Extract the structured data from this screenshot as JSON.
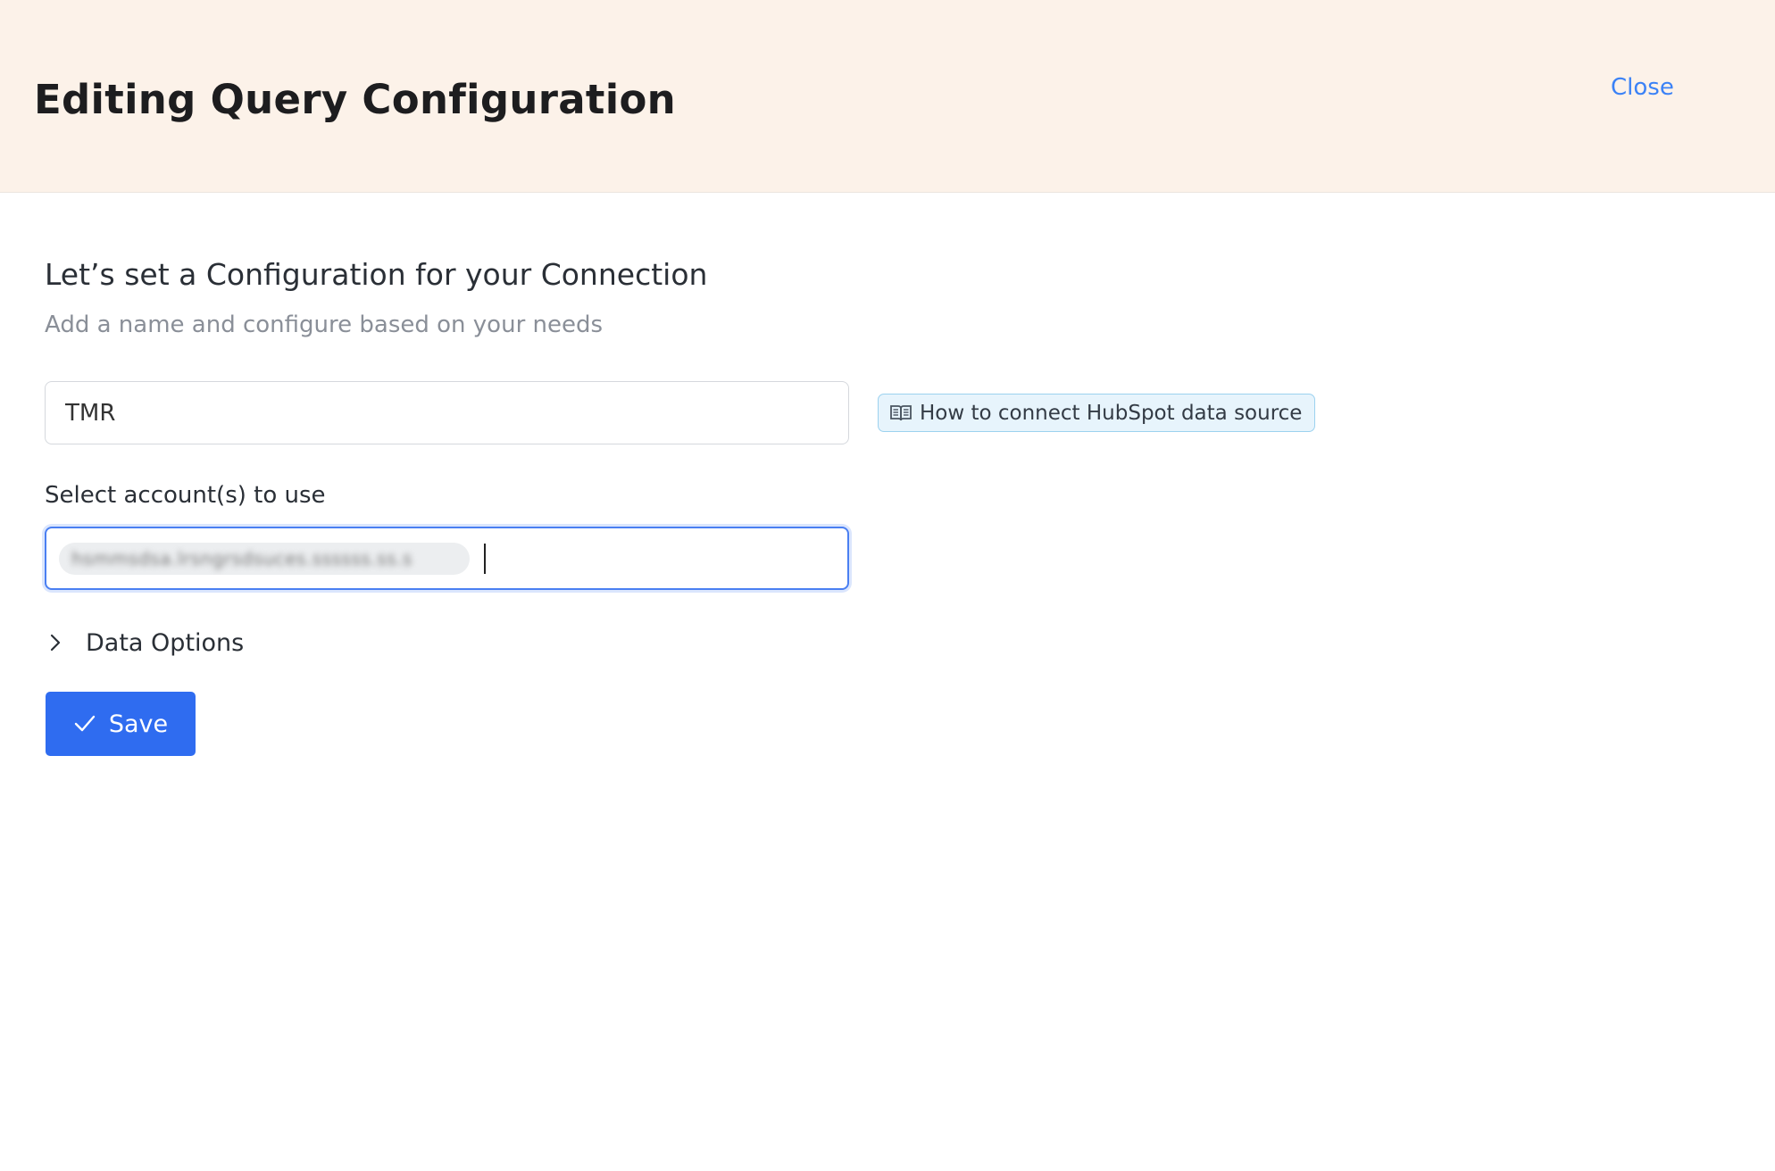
{
  "header": {
    "title": "Editing Query Configuration",
    "close_label": "Close"
  },
  "form": {
    "section_title": "Let’s set a Configuration for your Connection",
    "section_subtitle": "Add a name and configure based on your needs",
    "name_value": "TMR",
    "help_link": {
      "label": "How to connect HubSpot data source",
      "icon": "book-icon"
    },
    "accounts_label": "Select account(s) to use",
    "selected_account": "hsmmsdsa.lrsngrsdsuces.ssssss.ss.s",
    "data_options_label": "Data Options",
    "data_options_icon": "chevron-right-icon",
    "save_label": "Save",
    "save_icon": "check-icon"
  },
  "colors": {
    "header_bg": "#fcf2e9",
    "accent": "#2f6cf0",
    "link": "#3b82f6",
    "help_badge_bg": "#e7f4fc"
  }
}
